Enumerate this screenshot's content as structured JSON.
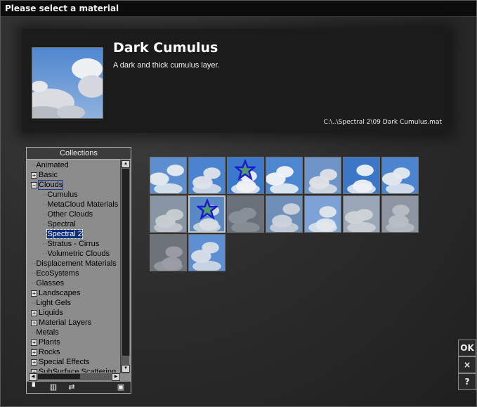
{
  "window": {
    "title": "Please select a material"
  },
  "material": {
    "name": "Dark Cumulus",
    "description": "A dark and thick cumulus layer.",
    "path": "C:\\..\\Spectral 2\\09 Dark Cumulus.mat"
  },
  "collections": {
    "header": "Collections",
    "items": [
      {
        "label": "Animated",
        "level": 0,
        "expander": ""
      },
      {
        "label": "Basic",
        "level": 0,
        "expander": "+"
      },
      {
        "label": "Clouds",
        "level": 0,
        "expander": "-"
      },
      {
        "label": "Cumulus",
        "level": 1,
        "expander": ""
      },
      {
        "label": "MetaCloud Materials",
        "level": 1,
        "expander": ""
      },
      {
        "label": "Other Clouds",
        "level": 1,
        "expander": ""
      },
      {
        "label": "Spectral",
        "level": 1,
        "expander": ""
      },
      {
        "label": "Spectral 2",
        "level": 1,
        "expander": ""
      },
      {
        "label": "Stratus - Cirrus",
        "level": 1,
        "expander": ""
      },
      {
        "label": "Volumetric Clouds",
        "level": 1,
        "expander": ""
      },
      {
        "label": "Displacement Materials",
        "level": 0,
        "expander": ""
      },
      {
        "label": "EcoSystems",
        "level": 0,
        "expander": ""
      },
      {
        "label": "Glasses",
        "level": 0,
        "expander": ""
      },
      {
        "label": "Landscapes",
        "level": 0,
        "expander": "+"
      },
      {
        "label": "Light Gels",
        "level": 0,
        "expander": ""
      },
      {
        "label": "Liquids",
        "level": 0,
        "expander": "+"
      },
      {
        "label": "Material Layers",
        "level": 0,
        "expander": "+"
      },
      {
        "label": "Metals",
        "level": 0,
        "expander": ""
      },
      {
        "label": "Plants",
        "level": 0,
        "expander": "+"
      },
      {
        "label": "Rocks",
        "level": 0,
        "expander": "+"
      },
      {
        "label": "Special Effects",
        "level": 0,
        "expander": "+"
      },
      {
        "label": "SubSurface Scattering",
        "level": 0,
        "expander": "+"
      }
    ]
  },
  "materials_grid": [
    {
      "sky": "#5d8fd0",
      "cloud": "#e8ecf0",
      "star": false
    },
    {
      "sky": "#4a83cf",
      "cloud": "#dfe4ea",
      "star": false
    },
    {
      "sky": "#3a78cc",
      "cloud": "#f0f2f5",
      "star": true
    },
    {
      "sky": "#4d86d1",
      "cloud": "#f2f4f7",
      "star": false
    },
    {
      "sky": "#6f95c8",
      "cloud": "#dfe2e6",
      "star": false
    },
    {
      "sky": "#3b76c7",
      "cloud": "#eef1f4",
      "star": false
    },
    {
      "sky": "#4b84cf",
      "cloud": "#e6eaee",
      "star": false
    },
    {
      "sky": "#8895a4",
      "cloud": "#c9cdd2",
      "star": false
    },
    {
      "sky": "#5a89c6",
      "cloud": "#d8dde3",
      "star": true
    },
    {
      "sky": "#6a7079",
      "cloud": "#8a9099",
      "star": false
    },
    {
      "sky": "#6d8fb8",
      "cloud": "#cfd4da",
      "star": false
    },
    {
      "sky": "#7ca2d6",
      "cloud": "#e3e7ec",
      "star": false
    },
    {
      "sky": "#9aa7b6",
      "cloud": "#cfd3d8",
      "star": false
    },
    {
      "sky": "#8d96a2",
      "cloud": "#b9bec5",
      "star": false
    },
    {
      "sky": "#6e737a",
      "cloud": "#9a9ea4",
      "star": false
    },
    {
      "sky": "#5e8fd2",
      "cloud": "#d9dfe6",
      "star": false
    }
  ],
  "buttons": {
    "ok": "OK",
    "cancel": "×",
    "help": "?"
  },
  "icons": {
    "new_collection": "new-collection-icon",
    "delete_collection": "trash-icon",
    "import": "folder-import-icon",
    "settings": "settings-icon"
  }
}
